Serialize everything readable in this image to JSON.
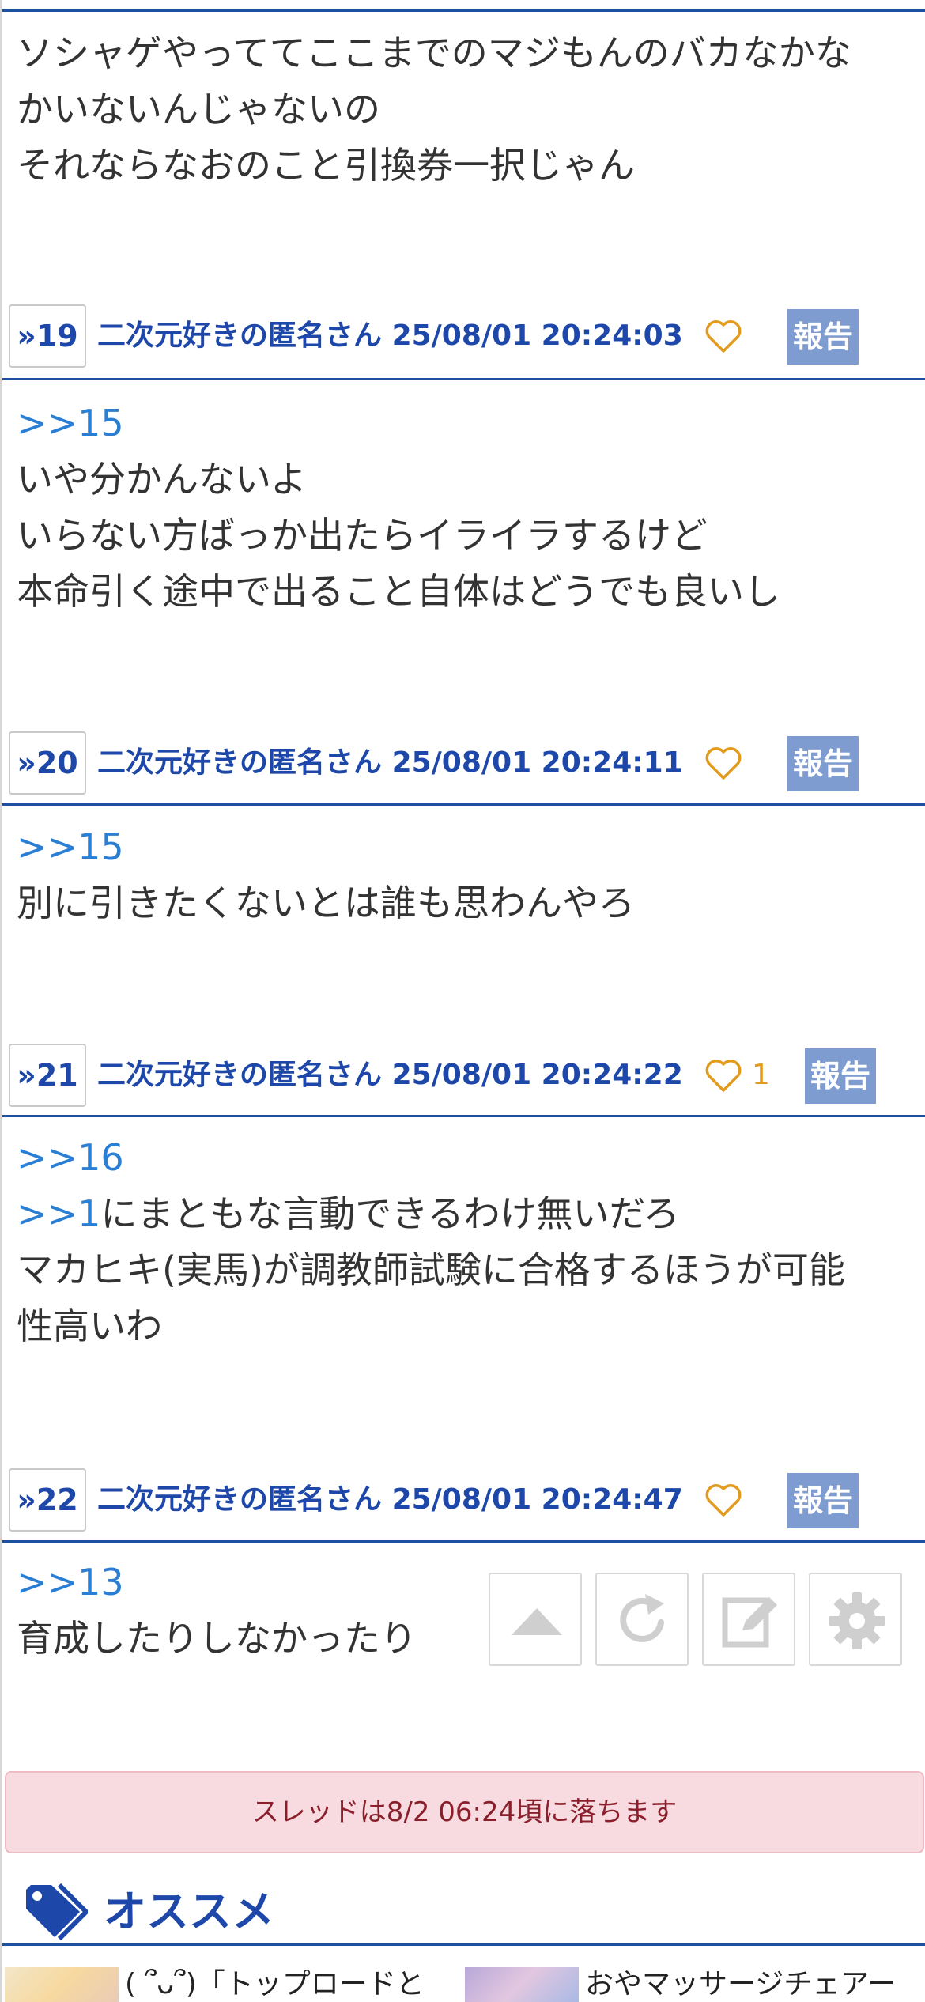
{
  "posts": [
    {
      "lines": [
        [
          {
            "t": "ソシャゲやっててここまでのマジもんのバカなかな",
            "a": false
          }
        ],
        [
          {
            "t": "かいないんじゃないの",
            "a": false
          }
        ],
        [
          {
            "t": "それならなおのこと引換券一択じゃん",
            "a": false
          }
        ]
      ]
    },
    {
      "num": "»19",
      "author": "二次元好きの匿名さん",
      "date": "25/08/01 20:24:03",
      "likes": "",
      "report": "報告",
      "lines": [
        [
          {
            "t": ">>15",
            "a": true
          }
        ],
        [
          {
            "t": "いや分かんないよ",
            "a": false
          }
        ],
        [
          {
            "t": "いらない方ばっか出たらイライラするけど",
            "a": false
          }
        ],
        [
          {
            "t": "本命引く途中で出ること自体はどうでも良いし",
            "a": false
          }
        ]
      ]
    },
    {
      "num": "»20",
      "author": "二次元好きの匿名さん",
      "date": "25/08/01 20:24:11",
      "likes": "",
      "report": "報告",
      "lines": [
        [
          {
            "t": ">>15",
            "a": true
          }
        ],
        [
          {
            "t": "別に引きたくないとは誰も思わんやろ",
            "a": false
          }
        ]
      ]
    },
    {
      "num": "»21",
      "author": "二次元好きの匿名さん",
      "date": "25/08/01 20:24:22",
      "likes": "1",
      "report": "報告",
      "lines": [
        [
          {
            "t": ">>16",
            "a": true
          }
        ],
        [
          {
            "t": ">>1",
            "a": true
          },
          {
            "t": "にまともな言動できるわけ無いだろ",
            "a": false
          }
        ],
        [
          {
            "t": "マカヒキ(実馬)が調教師試験に合格するほうが可能",
            "a": false
          }
        ],
        [
          {
            "t": "性高いわ",
            "a": false
          }
        ]
      ]
    },
    {
      "num": "»22",
      "author": "二次元好きの匿名さん",
      "date": "25/08/01 20:24:47",
      "likes": "",
      "report": "報告",
      "lines": [
        [
          {
            "t": ">>13",
            "a": true
          }
        ],
        [
          {
            "t": "育成したりしなかったり",
            "a": false
          }
        ]
      ]
    }
  ],
  "toolbar": {
    "icons": [
      "scroll-top-icon",
      "reload-icon",
      "edit-icon",
      "settings-icon"
    ]
  },
  "notice": "スレッドは8/2 06:24頃に落ちます",
  "recommend": {
    "title": "オススメ",
    "items": [
      {
        "text": "( ՞ᴗ՞)「トップロードと"
      },
      {
        "text": "おやマッサージチェアー"
      }
    ]
  },
  "colors": {
    "accent": "#1d47a8",
    "anchor": "#2a7fd4",
    "like": "#e29b1d",
    "report_bg": "#7e9cd0",
    "notice_bg": "#f7dbe0"
  }
}
